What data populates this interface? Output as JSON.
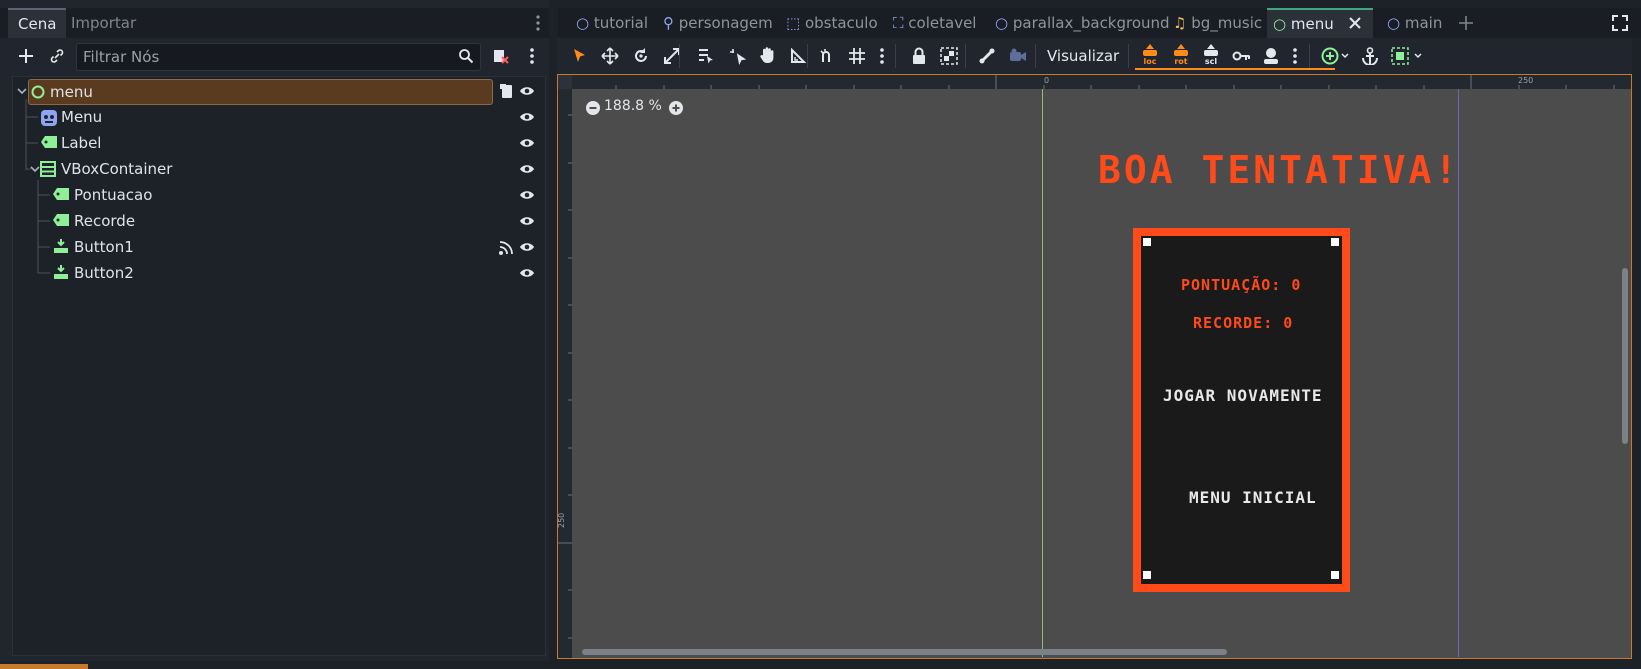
{
  "scene_dock": {
    "tabs": [
      {
        "label": "Cena",
        "active": true
      },
      {
        "label": "Importar",
        "active": false
      }
    ],
    "filter_placeholder": "Filtrar Nós",
    "tree": [
      {
        "label": "menu",
        "icon": "control-node-icon",
        "selected": true
      },
      {
        "label": "Menu",
        "icon": "sprite-node-icon"
      },
      {
        "label": "Label",
        "icon": "label-node-icon"
      },
      {
        "label": "VBoxContainer",
        "icon": "vbox-node-icon"
      },
      {
        "label": "Pontuacao",
        "icon": "label-node-icon"
      },
      {
        "label": "Recorde",
        "icon": "label-node-icon"
      },
      {
        "label": "Button1",
        "icon": "button-node-icon"
      },
      {
        "label": "Button2",
        "icon": "button-node-icon"
      }
    ]
  },
  "editor_tabs": [
    {
      "label": "tutorial",
      "icon": "circle-icon",
      "active": false
    },
    {
      "label": "personagem",
      "icon": "character-icon",
      "active": false
    },
    {
      "label": "obstaculo",
      "icon": "area-icon",
      "active": false
    },
    {
      "label": "coletavel",
      "icon": "collectible-icon",
      "active": false
    },
    {
      "label": "parallax_background",
      "icon": "circle-icon",
      "active": false
    },
    {
      "label": "bg_music",
      "icon": "music-icon",
      "active": false
    },
    {
      "label": "menu",
      "icon": "circle-icon",
      "active": true
    },
    {
      "label": "main",
      "icon": "circle-icon",
      "active": false
    }
  ],
  "toolbar": {
    "view_menu_label": "Visualizar",
    "key_labels": [
      "loc",
      "rot",
      "scl"
    ]
  },
  "viewport": {
    "zoom": "188.8 %",
    "ruler_top_labels": [
      "0",
      "250"
    ],
    "ruler_left_labels": [
      "250"
    ]
  },
  "game": {
    "title": "BOA TENTATIVA!",
    "score": "PONTUAÇÃO: 0",
    "record": "RECORDE: 0",
    "play_again": "JOGAR NOVAMENTE",
    "main_menu": "MENU INICIAL"
  },
  "colors": {
    "accent_orange": "#ff4a1a",
    "selection_brown": "#5a3b1f",
    "active_tab_green": "#3ea87a",
    "viewport_bg": "#4c4c4c"
  }
}
